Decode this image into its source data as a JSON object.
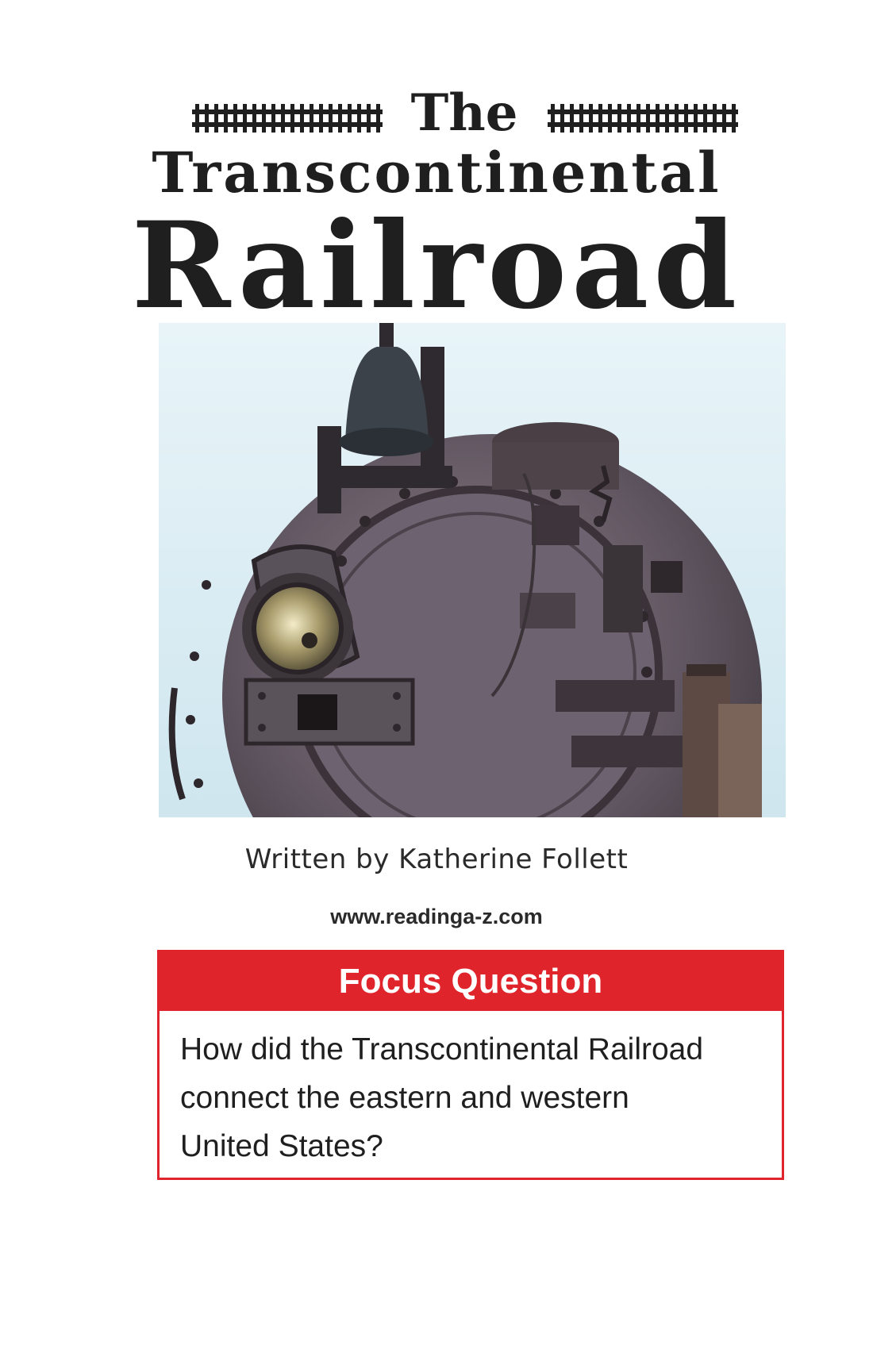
{
  "cover": {
    "title_line_1": "The",
    "title_line_2": "Transcontinental",
    "title_line_3": "Railroad",
    "author_line": "Written by Katherine Follett",
    "website": "www.readinga-z.com"
  },
  "photo": {
    "subject": "steam-locomotive-front",
    "sky_color": "#dceef5"
  },
  "focus": {
    "header": "Focus Question",
    "question": "How did the Transcontinental Railroad\nconnect the eastern and western\nUnited States?",
    "accent_color": "#e0242b"
  }
}
